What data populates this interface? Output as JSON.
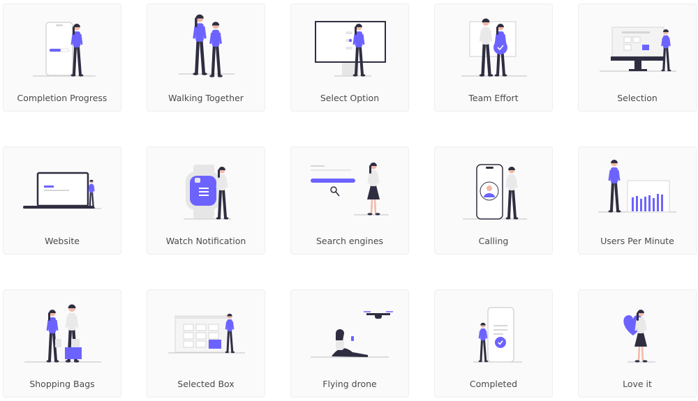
{
  "colors": {
    "accent": "#6c63ff",
    "dark": "#2f2e41",
    "card_bg": "#fafafa",
    "text": "#4a4a4a"
  },
  "cards": [
    {
      "title": "Completion Progress",
      "scene": "completion-progress"
    },
    {
      "title": "Walking Together",
      "scene": "walking-together"
    },
    {
      "title": "Select Option",
      "scene": "select-option"
    },
    {
      "title": "Team Effort",
      "scene": "team-effort"
    },
    {
      "title": "Selection",
      "scene": "selection"
    },
    {
      "title": "Website",
      "scene": "website"
    },
    {
      "title": "Watch Notification",
      "scene": "watch-notification"
    },
    {
      "title": "Search engines",
      "scene": "search-engines"
    },
    {
      "title": "Calling",
      "scene": "calling"
    },
    {
      "title": "Users Per Minute",
      "scene": "users-per-minute"
    },
    {
      "title": "Shopping Bags",
      "scene": "shopping-bags"
    },
    {
      "title": "Selected Box",
      "scene": "selected-box"
    },
    {
      "title": "Flying drone",
      "scene": "flying-drone"
    },
    {
      "title": "Completed",
      "scene": "completed"
    },
    {
      "title": "Love it",
      "scene": "love-it"
    }
  ]
}
